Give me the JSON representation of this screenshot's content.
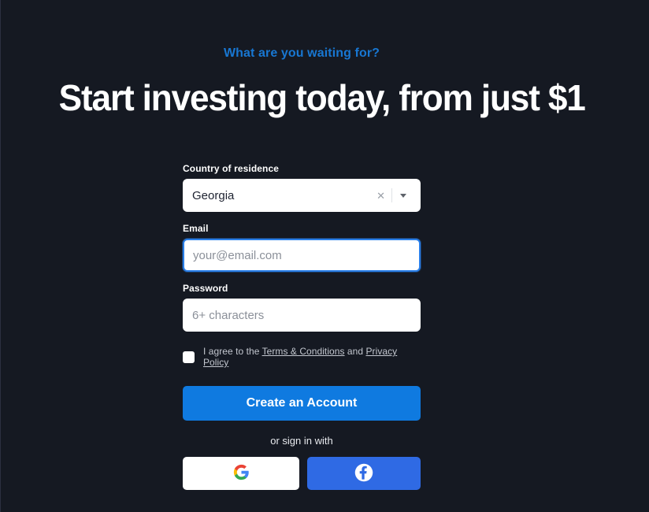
{
  "hero": {
    "eyebrow": "What are you waiting for?",
    "headline": "Start investing today, from just $1"
  },
  "form": {
    "country": {
      "label": "Country of residence",
      "value": "Georgia",
      "clear_icon": "close-x-icon",
      "dropdown_icon": "caret-down-icon"
    },
    "email": {
      "label": "Email",
      "placeholder": "your@email.com",
      "value": "",
      "focused": true
    },
    "password": {
      "label": "Password",
      "placeholder": "6+ characters",
      "value": ""
    },
    "terms": {
      "checked": false,
      "prefix": "I agree to the ",
      "terms_link": "Terms & Conditions",
      "conjunction": " and ",
      "privacy_link": "Privacy Policy"
    },
    "submit_label": "Create an Account",
    "divider_text": "or sign in with",
    "social": [
      {
        "name": "google",
        "icon": "google-g-icon"
      },
      {
        "name": "facebook",
        "icon": "facebook-f-icon"
      }
    ]
  },
  "colors": {
    "background": "#151922",
    "accent_blue": "#0f7ae0",
    "eyebrow_blue": "#1877d2",
    "facebook_blue": "#2f6ae4",
    "focus_blue": "#2a7fe8",
    "text_white": "#ffffff",
    "muted_text": "#c3c7cf",
    "placeholder": "#8b9099"
  }
}
